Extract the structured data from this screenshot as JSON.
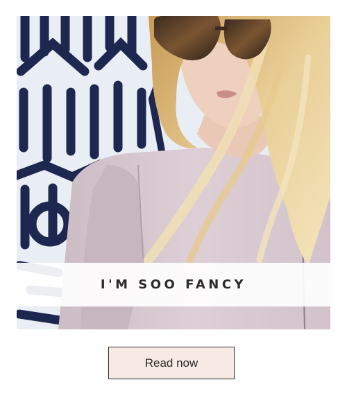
{
  "card": {
    "image_alt": "Blonde woman in sunglasses and pale pink blazer against black-and-white mural",
    "caption": "I'M SOO FANCY"
  },
  "cta": {
    "label": "Read now"
  },
  "colors": {
    "button_bg": "#f7e9e3",
    "button_border": "#2b2b2b",
    "caption_text": "#2b2b2b",
    "caption_band": "#ffffff"
  }
}
